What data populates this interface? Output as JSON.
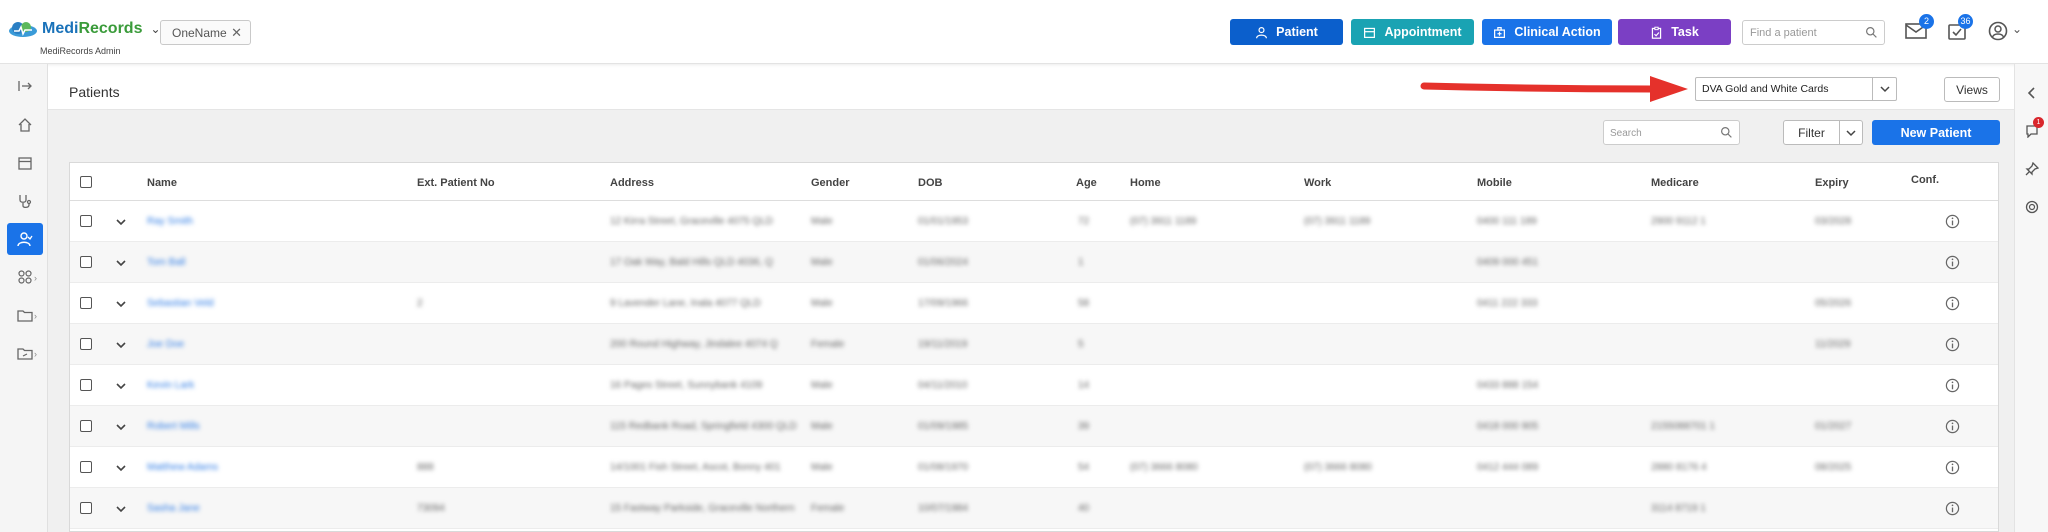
{
  "app": {
    "logo_medi": "Medi",
    "logo_records": "Records",
    "subtitle": "MediRecords Admin",
    "open_tab": "OneName"
  },
  "topbar": {
    "buttons": [
      {
        "label": "Patient",
        "color": "#0b5fcc"
      },
      {
        "label": "Appointment",
        "color": "#1aa3b3"
      },
      {
        "label": "Clinical Action",
        "color": "#1a73e8"
      },
      {
        "label": "Task",
        "color": "#7b3fc4"
      }
    ],
    "find_placeholder": "Find a patient",
    "mail_badge": "2",
    "tasks_badge": "36"
  },
  "page": {
    "title": "Patients",
    "view_selected": "DVA Gold and White Cards",
    "views_label": "Views",
    "search_placeholder": "Search",
    "filter_label": "Filter",
    "new_patient_label": "New Patient"
  },
  "right_panel": {
    "notification_badge": "1"
  },
  "table": {
    "columns": [
      "Name",
      "Ext. Patient No",
      "Address",
      "Gender",
      "DOB",
      "Age",
      "Home",
      "Work",
      "Mobile",
      "Medicare",
      "Expiry",
      "Conf."
    ],
    "rows": [
      {
        "name": "Ray Smith",
        "ext": "",
        "address": "12 Kirra Street, Graceville 4075 QLD",
        "gender": "Male",
        "dob": "01/01/1953",
        "age": "72",
        "home": "(07) 3911 1189",
        "work": "(07) 3911 1189",
        "mobile": "0400 111 189",
        "medicare": "2900 9112 1",
        "expiry": "03/2028"
      },
      {
        "name": "Tom Ball",
        "ext": "",
        "address": "17 Oak Way, Bald Hills QLD 4036, Q",
        "gender": "Male",
        "dob": "01/06/2024",
        "age": "1",
        "home": "",
        "work": "",
        "mobile": "0409 000 451",
        "medicare": "",
        "expiry": ""
      },
      {
        "name": "Sebastian Veld",
        "ext": "2",
        "address": "9 Lavender Lane, Inala 4077 QLD",
        "gender": "Male",
        "dob": "17/09/1966",
        "age": "58",
        "home": "",
        "work": "",
        "mobile": "0411 222 333",
        "medicare": "",
        "expiry": "05/2026"
      },
      {
        "name": "Joe Doe",
        "ext": "",
        "address": "200 Round Highway, Jindalee 4074 Q",
        "gender": "Female",
        "dob": "19/11/2019",
        "age": "5",
        "home": "",
        "work": "",
        "mobile": "",
        "medicare": "",
        "expiry": "11/2029"
      },
      {
        "name": "Kevin Lark",
        "ext": "",
        "address": "16 Pages Street, Sunnybank 4109",
        "gender": "Male",
        "dob": "04/11/2010",
        "age": "14",
        "home": "",
        "work": "",
        "mobile": "0433 888 154",
        "medicare": "",
        "expiry": ""
      },
      {
        "name": "Robert Mills",
        "ext": "",
        "address": "115 Redbank Road, Springfield 4300 QLD",
        "gender": "Male",
        "dob": "01/09/1985",
        "age": "39",
        "home": "",
        "work": "",
        "mobile": "0418 000 905",
        "medicare": "2155088701 1",
        "expiry": "01/2027"
      },
      {
        "name": "Matthew Adams",
        "ext": "888",
        "address": "14/1001 Fish Street, Ascot, Bonny 401",
        "gender": "Male",
        "dob": "01/08/1970",
        "age": "54",
        "home": "(07) 3666 8080",
        "work": "(07) 3666 8080",
        "mobile": "0412 444 089",
        "medicare": "2880 8176 4",
        "expiry": "08/2025"
      },
      {
        "name": "Sasha Jane",
        "ext": "73094",
        "address": "15 Fastway Parkside, Graceville Northern",
        "gender": "Female",
        "dob": "10/07/1984",
        "age": "40",
        "home": "",
        "work": "",
        "mobile": "",
        "medicare": "3114 8719 1",
        "expiry": ""
      }
    ]
  }
}
